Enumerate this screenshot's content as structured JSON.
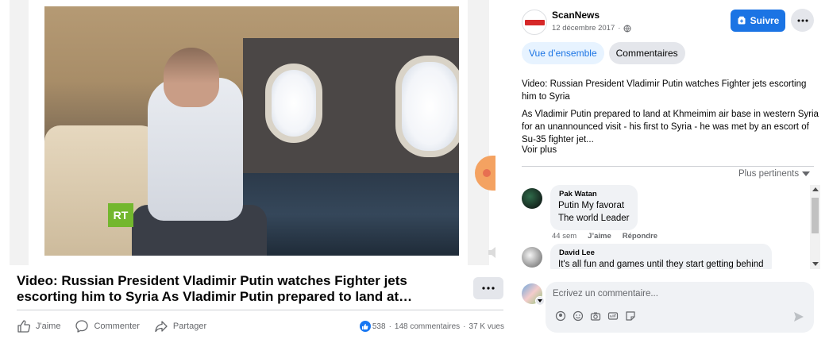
{
  "video": {
    "title": "Video: Russian President Vladimir Putin watches Fighter jets escorting him to Syria As Vladimir Putin prepared to land at Khmeimim air base in western Syria for an unannounced visit",
    "channel_logo": "RT"
  },
  "actions": {
    "like_label": "J'aime",
    "comment_label": "Commenter",
    "share_label": "Partager"
  },
  "stats": {
    "reactions": "538",
    "comments": "148 commentaires",
    "views": "37 K vues",
    "separator": "·"
  },
  "post": {
    "page_name": "ScanNews",
    "date": "12 décembre 2017",
    "follow_label": "Suivre",
    "headline": "Video: Russian President Vladimir Putin watches Fighter jets escorting him to Syria",
    "body": "As Vladimir Putin prepared to land at Khmeimim air base in western Syria for an unannounced visit - his first to Syria - he was met by an escort of Su-35 fighter jet...",
    "see_more": "Voir plus"
  },
  "tabs": [
    {
      "label": "Vue d’ensemble",
      "active": true
    },
    {
      "label": "Commentaires",
      "active": false
    }
  ],
  "sort": {
    "label": "Plus pertinents"
  },
  "comments": [
    {
      "author": "Pak Watan",
      "text": "Putin My favorat\nThe world Leader",
      "time": "44 sem",
      "like_label": "J’aime",
      "reply_label": "Répondre",
      "avatar_color": "#1e3a2f"
    },
    {
      "author": "David Lee",
      "text": "It's all fun and games until they start getting behind",
      "avatar_color": "#9e9e9e"
    }
  ],
  "composer": {
    "placeholder": "Écrivez un commentaire..."
  },
  "icons": {
    "like": "thumbs-up-icon",
    "comment": "speech-bubble-icon",
    "share": "share-arrow-icon",
    "more": "ellipsis-icon",
    "globe": "globe-icon",
    "send": "send-icon"
  },
  "colors": {
    "accent": "#1b74e4",
    "text_secondary": "#65676b",
    "bubble": "#f0f2f5"
  }
}
